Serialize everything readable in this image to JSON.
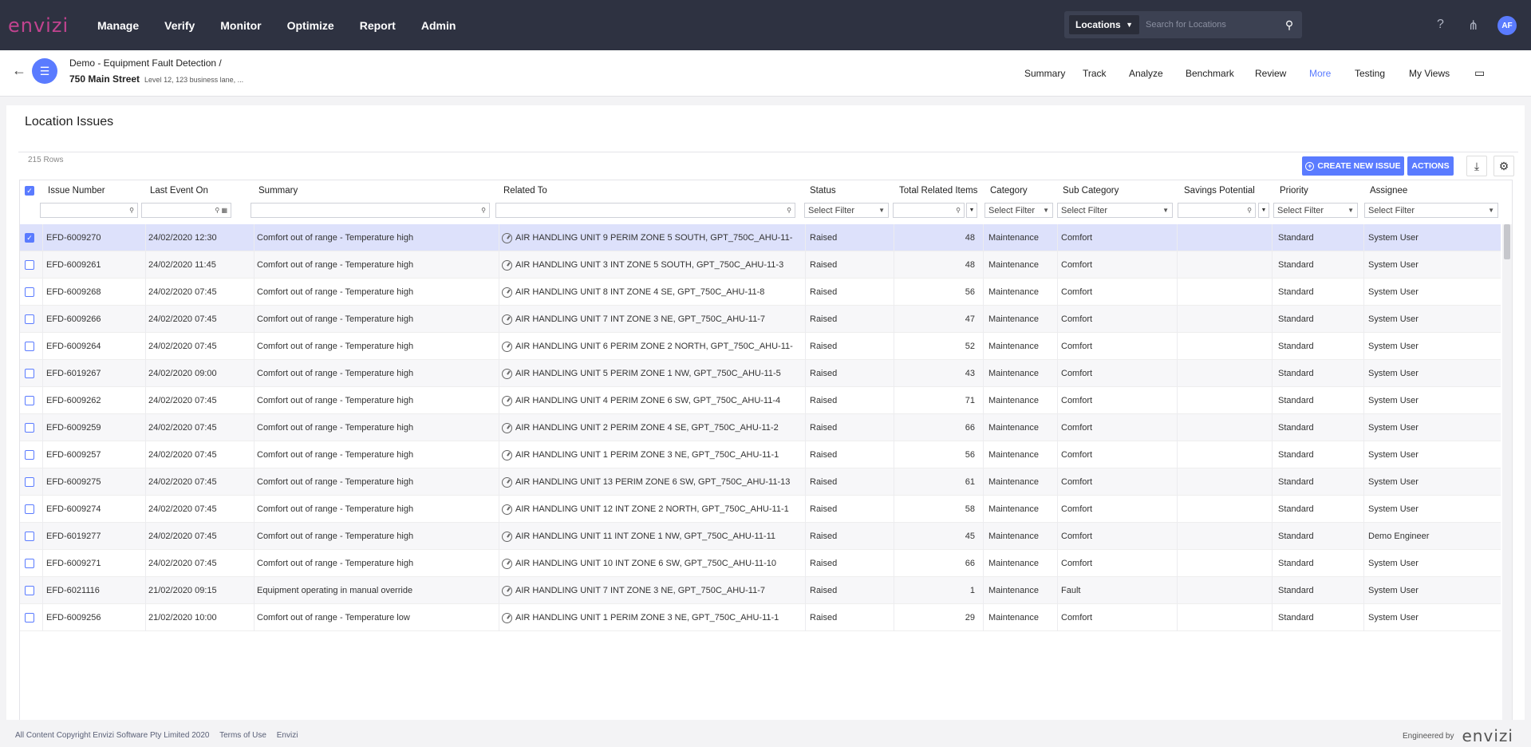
{
  "app": {
    "logo": "envizi"
  },
  "topnav": {
    "items": [
      "Manage",
      "Verify",
      "Monitor",
      "Optimize",
      "Report",
      "Admin"
    ],
    "search": {
      "scope": "Locations",
      "placeholder": "Search for Locations"
    },
    "avatar": "AF",
    "icons": [
      "help-icon",
      "hierarchy-icon"
    ]
  },
  "subheader": {
    "crumb1": "Demo - Equipment Fault Detection  /",
    "location": "750 Main Street",
    "address": "Level 12, 123 business lane, ...",
    "tabs": [
      "Summary",
      "Track",
      "Analyze",
      "Benchmark",
      "Review",
      "More",
      "Testing",
      "My Views"
    ],
    "active_tab": "More"
  },
  "panel": {
    "title": "Location Issues",
    "row_count": "215 Rows",
    "create_label": "CREATE NEW ISSUE",
    "actions_label": "ACTIONS"
  },
  "grid": {
    "columns": [
      "Issue Number",
      "Last Event On",
      "Summary",
      "Related To",
      "Status",
      "Total Related Items",
      "Category",
      "Sub Category",
      "Savings Potential",
      "Priority",
      "Assignee"
    ],
    "filter_placeholder": "Select Filter",
    "rows": [
      {
        "id": "EFD-6009270",
        "date": "24/02/2020 12:30",
        "summary": "Comfort out of range - Temperature high",
        "related": "AIR HANDLING UNIT 9 PERIM ZONE 5 SOUTH, GPT_750C_AHU-11-",
        "status": "Raised",
        "total": "48",
        "category": "Maintenance",
        "sub": "Comfort",
        "savings": "",
        "priority": "Standard",
        "assignee": "System User",
        "checked": true
      },
      {
        "id": "EFD-6009261",
        "date": "24/02/2020 11:45",
        "summary": "Comfort out of range - Temperature high",
        "related": "AIR HANDLING UNIT 3 INT ZONE 5 SOUTH, GPT_750C_AHU-11-3",
        "status": "Raised",
        "total": "48",
        "category": "Maintenance",
        "sub": "Comfort",
        "savings": "",
        "priority": "Standard",
        "assignee": "System User",
        "checked": false
      },
      {
        "id": "EFD-6009268",
        "date": "24/02/2020 07:45",
        "summary": "Comfort out of range - Temperature high",
        "related": "AIR HANDLING UNIT 8 INT ZONE 4 SE, GPT_750C_AHU-11-8",
        "status": "Raised",
        "total": "56",
        "category": "Maintenance",
        "sub": "Comfort",
        "savings": "",
        "priority": "Standard",
        "assignee": "System User",
        "checked": false
      },
      {
        "id": "EFD-6009266",
        "date": "24/02/2020 07:45",
        "summary": "Comfort out of range - Temperature high",
        "related": "AIR HANDLING UNIT 7 INT ZONE 3 NE, GPT_750C_AHU-11-7",
        "status": "Raised",
        "total": "47",
        "category": "Maintenance",
        "sub": "Comfort",
        "savings": "",
        "priority": "Standard",
        "assignee": "System User",
        "checked": false
      },
      {
        "id": "EFD-6009264",
        "date": "24/02/2020 07:45",
        "summary": "Comfort out of range - Temperature high",
        "related": "AIR HANDLING UNIT 6 PERIM ZONE 2 NORTH, GPT_750C_AHU-11-",
        "status": "Raised",
        "total": "52",
        "category": "Maintenance",
        "sub": "Comfort",
        "savings": "",
        "priority": "Standard",
        "assignee": "System User",
        "checked": false
      },
      {
        "id": "EFD-6019267",
        "date": "24/02/2020 09:00",
        "summary": "Comfort out of range - Temperature high",
        "related": "AIR HANDLING UNIT 5 PERIM ZONE 1 NW, GPT_750C_AHU-11-5",
        "status": "Raised",
        "total": "43",
        "category": "Maintenance",
        "sub": "Comfort",
        "savings": "",
        "priority": "Standard",
        "assignee": "System User",
        "checked": false
      },
      {
        "id": "EFD-6009262",
        "date": "24/02/2020 07:45",
        "summary": "Comfort out of range - Temperature high",
        "related": "AIR HANDLING UNIT 4 PERIM ZONE 6 SW, GPT_750C_AHU-11-4",
        "status": "Raised",
        "total": "71",
        "category": "Maintenance",
        "sub": "Comfort",
        "savings": "",
        "priority": "Standard",
        "assignee": "System User",
        "checked": false
      },
      {
        "id": "EFD-6009259",
        "date": "24/02/2020 07:45",
        "summary": "Comfort out of range - Temperature high",
        "related": "AIR HANDLING UNIT 2 PERIM ZONE 4 SE, GPT_750C_AHU-11-2",
        "status": "Raised",
        "total": "66",
        "category": "Maintenance",
        "sub": "Comfort",
        "savings": "",
        "priority": "Standard",
        "assignee": "System User",
        "checked": false
      },
      {
        "id": "EFD-6009257",
        "date": "24/02/2020 07:45",
        "summary": "Comfort out of range - Temperature high",
        "related": "AIR HANDLING UNIT 1 PERIM ZONE 3 NE, GPT_750C_AHU-11-1",
        "status": "Raised",
        "total": "56",
        "category": "Maintenance",
        "sub": "Comfort",
        "savings": "",
        "priority": "Standard",
        "assignee": "System User",
        "checked": false
      },
      {
        "id": "EFD-6009275",
        "date": "24/02/2020 07:45",
        "summary": "Comfort out of range - Temperature high",
        "related": "AIR HANDLING UNIT 13 PERIM ZONE 6 SW, GPT_750C_AHU-11-13",
        "status": "Raised",
        "total": "61",
        "category": "Maintenance",
        "sub": "Comfort",
        "savings": "",
        "priority": "Standard",
        "assignee": "System User",
        "checked": false
      },
      {
        "id": "EFD-6009274",
        "date": "24/02/2020 07:45",
        "summary": "Comfort out of range - Temperature high",
        "related": "AIR HANDLING UNIT 12 INT ZONE 2 NORTH, GPT_750C_AHU-11-1",
        "status": "Raised",
        "total": "58",
        "category": "Maintenance",
        "sub": "Comfort",
        "savings": "",
        "priority": "Standard",
        "assignee": "System User",
        "checked": false
      },
      {
        "id": "EFD-6019277",
        "date": "24/02/2020 07:45",
        "summary": "Comfort out of range - Temperature high",
        "related": "AIR HANDLING UNIT 11 INT ZONE 1 NW, GPT_750C_AHU-11-11",
        "status": "Raised",
        "total": "45",
        "category": "Maintenance",
        "sub": "Comfort",
        "savings": "",
        "priority": "Standard",
        "assignee": "Demo Engineer",
        "checked": false
      },
      {
        "id": "EFD-6009271",
        "date": "24/02/2020 07:45",
        "summary": "Comfort out of range - Temperature high",
        "related": "AIR HANDLING UNIT 10 INT ZONE 6 SW, GPT_750C_AHU-11-10",
        "status": "Raised",
        "total": "66",
        "category": "Maintenance",
        "sub": "Comfort",
        "savings": "",
        "priority": "Standard",
        "assignee": "System User",
        "checked": false
      },
      {
        "id": "EFD-6021116",
        "date": "21/02/2020 09:15",
        "summary": "Equipment operating in manual override",
        "related": "AIR HANDLING UNIT 7 INT ZONE 3 NE, GPT_750C_AHU-11-7",
        "status": "Raised",
        "total": "1",
        "category": "Maintenance",
        "sub": "Fault",
        "savings": "",
        "priority": "Standard",
        "assignee": "System User",
        "checked": false
      },
      {
        "id": "EFD-6009256",
        "date": "21/02/2020 10:00",
        "summary": "Comfort out of range - Temperature low",
        "related": "AIR HANDLING UNIT 1 PERIM ZONE 3 NE, GPT_750C_AHU-11-1",
        "status": "Raised",
        "total": "29",
        "category": "Maintenance",
        "sub": "Comfort",
        "savings": "",
        "priority": "Standard",
        "assignee": "System User",
        "checked": false
      }
    ]
  },
  "footer": {
    "copyright": "All Content Copyright Envizi Software Pty Limited 2020",
    "terms": "Terms of Use",
    "link": "Envizi",
    "engineered": "Engineered by",
    "logo": "envizi"
  },
  "colors": {
    "topbar": "#2e3241",
    "accent": "#5a7bff",
    "logo": "#c1438f"
  }
}
